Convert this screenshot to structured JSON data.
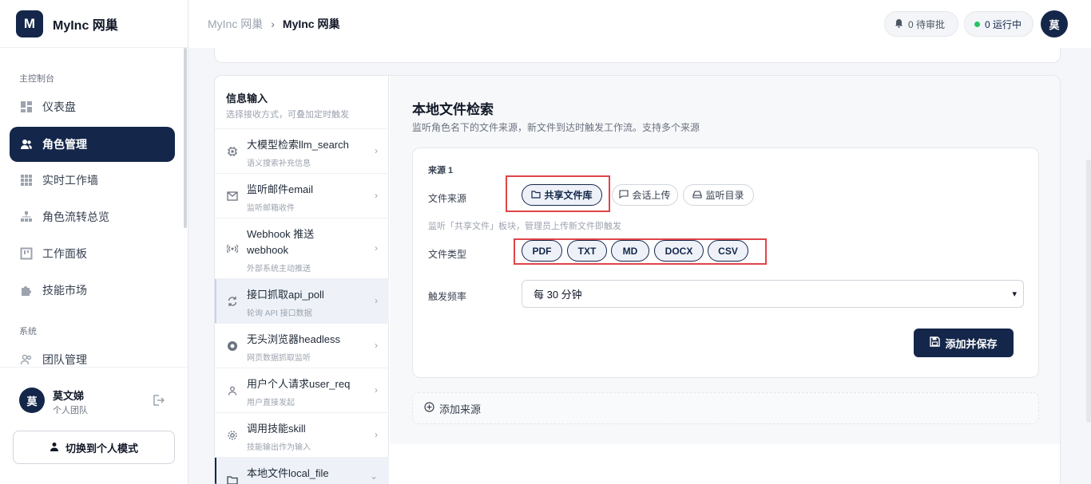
{
  "brand": {
    "logo_letter": "M",
    "name": "MyInc 网巢"
  },
  "nav": {
    "section_main": "主控制台",
    "items": [
      {
        "label": "仪表盘",
        "icon": "dashboard-icon"
      },
      {
        "label": "角色管理",
        "icon": "users-icon"
      },
      {
        "label": "实时工作墙",
        "icon": "grid-icon"
      },
      {
        "label": "角色流转总览",
        "icon": "flow-icon"
      },
      {
        "label": "工作面板",
        "icon": "panel-icon"
      },
      {
        "label": "技能市场",
        "icon": "puzzle-icon"
      }
    ],
    "section_system": "系统",
    "system_items": [
      {
        "label": "团队管理",
        "icon": "team-icon"
      }
    ]
  },
  "user": {
    "avatar": "莫",
    "name": "莫文娣",
    "team": "个人团队",
    "switch_label": "切换到个人模式"
  },
  "header": {
    "breadcrumb_parent": "MyInc 网巢",
    "breadcrumb_current": "MyInc 网巢",
    "pending_label": "0 待审批",
    "running_label": "0 运行中",
    "avatar": "莫"
  },
  "inputs": {
    "title": "信息输入",
    "subtitle": "选择接收方式，可叠加定时触发",
    "items": [
      {
        "name": "大模型检索llm_search",
        "desc": "语义搜索补充信息"
      },
      {
        "name": "监听邮件email",
        "desc": "监听邮箱收件"
      },
      {
        "name": "Webhook 推送",
        "name2": "webhook",
        "desc": "外部系统主动推送"
      },
      {
        "name": "接口抓取api_poll",
        "desc": "轮询 API 接口数据"
      },
      {
        "name": "无头浏览器headless",
        "desc": "网页数据抓取监听"
      },
      {
        "name": "用户个人请求user_req",
        "desc": "用户直接发起"
      },
      {
        "name": "调用技能skill",
        "desc": "技能输出作为输入"
      },
      {
        "name": "本地文件local_file",
        "desc": ""
      }
    ]
  },
  "detail": {
    "title": "本地文件检索",
    "subtitle": "监听角色名下的文件来源，新文件到达时触发工作流。支持多个来源",
    "source_label": "来源 1",
    "file_source_label": "文件来源",
    "source_options": [
      "共享文件库",
      "会话上传",
      "监听目录"
    ],
    "source_hint": "监听「共享文件」板块，管理员上传新文件即触发",
    "file_type_label": "文件类型",
    "file_types": [
      "PDF",
      "TXT",
      "MD",
      "DOCX",
      "CSV"
    ],
    "trigger_label": "触发频率",
    "trigger_value": "每 30 分钟",
    "save_label": "添加并保存",
    "add_source_label": "添加来源"
  },
  "colors": {
    "primary": "#14274a",
    "highlight": "#e0444a",
    "running_dot": "#22c55e"
  }
}
